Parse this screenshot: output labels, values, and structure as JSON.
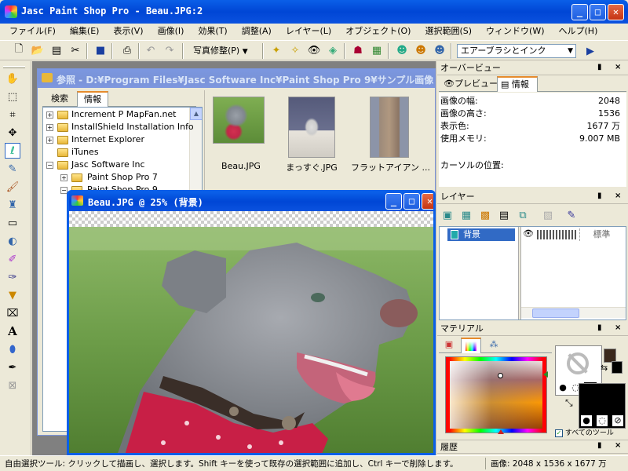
{
  "window": {
    "title": "Jasc Paint Shop Pro - Beau.JPG:2"
  },
  "menu": [
    "ファイル(F)",
    "編集(E)",
    "表示(V)",
    "画像(I)",
    "効果(T)",
    "調整(A)",
    "レイヤー(L)",
    "オブジェクト(O)",
    "選択範囲(S)",
    "ウィンドウ(W)",
    "ヘルプ(H)"
  ],
  "toolbar": {
    "photo_fix": "写真修整(P)",
    "brush_select": "エアーブラシとインク"
  },
  "browser": {
    "title": "参照 - D:¥Program Files¥Jasc Software Inc¥Paint Shop Pro 9¥サンプル画像",
    "tabs": [
      "検索",
      "情報"
    ],
    "tree": [
      "Increment P MapFan.net",
      "InstallShield Installation Info",
      "Internet Explorer",
      "iTunes",
      "Jasc Software Inc",
      "Paint Shop Pro 7",
      "Paint Shop Pro 9"
    ],
    "thumbs": [
      "Beau.JPG",
      "まっすぐ.JPG",
      "フラットアイアン ..."
    ]
  },
  "image_window": {
    "title": "Beau.JPG @ 25% (背景)"
  },
  "overview": {
    "title": "オーバービュー",
    "tabs": [
      "プレビュー",
      "情報"
    ],
    "rows": [
      {
        "k": "画像の幅:",
        "v": "2048"
      },
      {
        "k": "画像の高さ:",
        "v": "1536"
      },
      {
        "k": "表示色:",
        "v": "1677 万"
      },
      {
        "k": "使用メモリ:",
        "v": "9.007 MB"
      }
    ],
    "cursor_label": "カーソルの位置:"
  },
  "layers": {
    "title": "レイヤー",
    "layer_name": "背景",
    "blend": "標準"
  },
  "materials": {
    "title": "マテリアル",
    "all_tools": "すべてのツール"
  },
  "history": {
    "title": "履歴"
  },
  "status": {
    "hint": "自由選択ツール: クリックして描画し、選択します。Shift キーを使って既存の選択範囲に追加し、Ctrl キーで削除します。",
    "image_info": "画像:  2048 x 1536 x 1677 万"
  },
  "colors": {
    "titlebar": "#0a5fe8",
    "face": "#ece9d8",
    "selected": "#316ac5"
  }
}
